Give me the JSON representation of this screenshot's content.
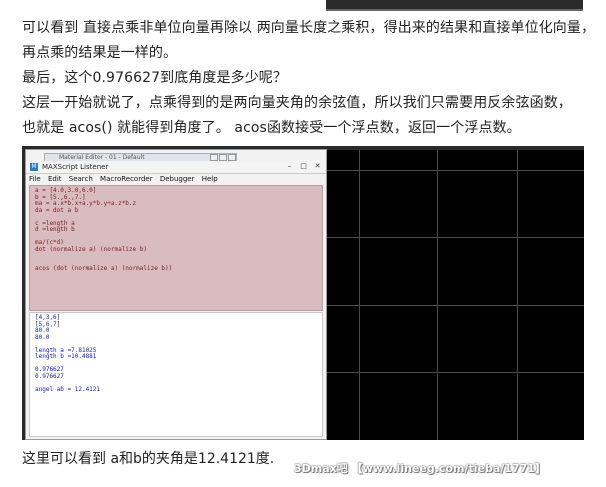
{
  "article": {
    "line1": "可以看到 直接点乘非单位向量再除以 两向量长度之乘积，得出来的结果和直接单位化向量，",
    "line2": "再点乘的结果是一样的。",
    "line3": "最后，这个0.976627到底角度是多少呢？",
    "line4": "这层一开始就说了，点乘得到的是两向量夹角的余弦值，所以我们只需要用反余弦函数，",
    "line5": "也就是 acos() 就能得到角度了。 acos函数接受一个浮点数，返回一个浮点数。",
    "caption": "这里可以看到 a和b的夹角是12.4121度."
  },
  "window": {
    "background_title": "Material Editor - 01 - Default",
    "title": "MAXScript Listener",
    "minimize": "–",
    "maximize": "□",
    "close": "✕"
  },
  "menu": [
    "File",
    "Edit",
    "Search",
    "MacroRecorder",
    "Debugger",
    "Help"
  ],
  "editor_lines": [
    "a = [4.0,3.0,6.0]",
    "b = [5.,6.,7.]",
    "ma = a.x*b.x+a.y*b.y+a.z*b.z",
    "da = dot a b",
    "",
    "c =length a",
    "d =length b",
    "",
    "ma/(c*d)",
    "dot (normalize a) (normalize b)",
    "",
    "",
    "acos (dot (normalize a) (normalize b))"
  ],
  "output_blue_lines": [
    "[4,3,6]",
    "[5,6,7]",
    "80.0",
    "80.0"
  ],
  "output_length_lines": [
    "length a =7.81025",
    "length b =10.4881"
  ],
  "output_result_lines": [
    "0.976627",
    "0.976627"
  ],
  "output_angle_line": "angel ab = 12.4121",
  "watermark": "3Dmax吧 【www.lineeg.com/tieba/1771】"
}
